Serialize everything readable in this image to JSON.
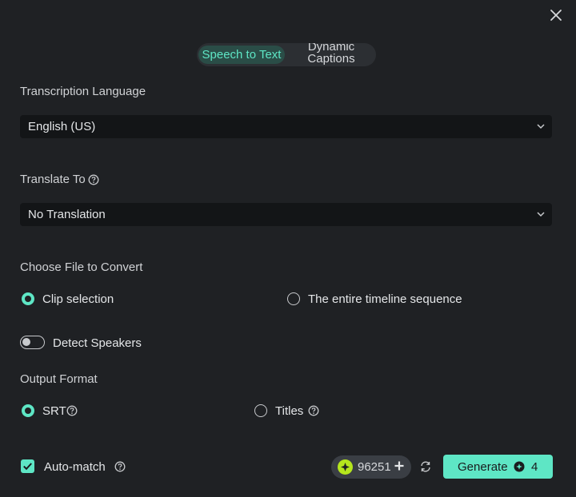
{
  "tabs": {
    "active": "Speech to Text",
    "other": "Dynamic Captions"
  },
  "transcription": {
    "label": "Transcription Language",
    "value": "English (US)"
  },
  "translate": {
    "label": "Translate To",
    "value": "No Translation"
  },
  "file": {
    "label": "Choose File to Convert",
    "option_clip": "Clip selection",
    "option_timeline": "The entire timeline sequence",
    "selected": "Clip selection"
  },
  "speakers": {
    "label": "Detect Speakers",
    "enabled": false
  },
  "output": {
    "label": "Output Format",
    "option_srt": "SRT",
    "option_titles": "Titles",
    "selected": "SRT"
  },
  "footer": {
    "automatch_label": "Auto-match",
    "automatch_checked": true,
    "credits": "96251",
    "generate_label": "Generate",
    "generate_cost": "4"
  },
  "colors": {
    "accent": "#5ee6c5",
    "background": "#1f2124",
    "field": "#131517",
    "coin": "#b5e61d"
  },
  "icons": [
    "close-icon",
    "chevron-down-icon",
    "help-icon",
    "plus-icon",
    "refresh-icon",
    "check-icon",
    "coin-icon"
  ]
}
